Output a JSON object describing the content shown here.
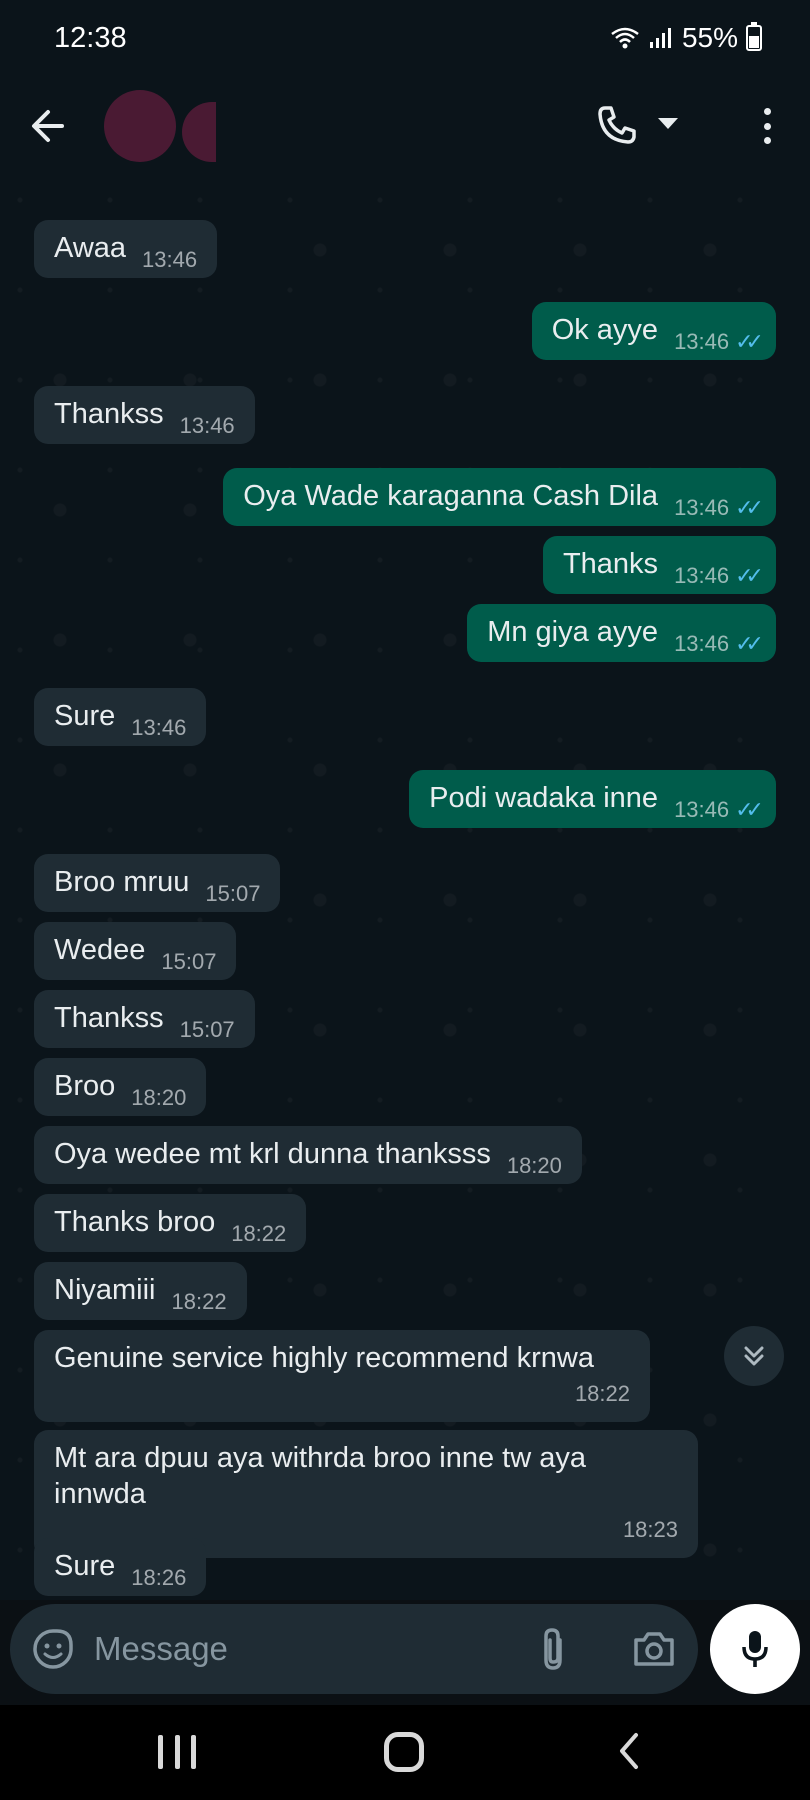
{
  "status_bar": {
    "time": "12:38",
    "battery": "55%",
    "icons": [
      "wifi-icon",
      "signal-icon",
      "battery-icon"
    ]
  },
  "header": {
    "icons": [
      "back-arrow-icon",
      "avatar",
      "phone-call-icon",
      "chevron-down-icon",
      "more-vert-icon"
    ]
  },
  "messages": [
    {
      "dir": "in",
      "text": "Awaa",
      "time": "13:46"
    },
    {
      "dir": "out",
      "text": "Ok ayye",
      "time": "13:46",
      "status": "read"
    },
    {
      "dir": "in",
      "text": "Thankss",
      "time": "13:46"
    },
    {
      "dir": "out",
      "text": "Oya Wade karaganna  Cash Dila",
      "time": "13:46",
      "status": "read"
    },
    {
      "dir": "out",
      "text": "Thanks",
      "time": "13:46",
      "status": "read"
    },
    {
      "dir": "out",
      "text": "Mn giya ayye",
      "time": "13:46",
      "status": "read"
    },
    {
      "dir": "in",
      "text": "Sure",
      "time": "13:46"
    },
    {
      "dir": "out",
      "text": "Podi wadaka inne",
      "time": "13:46",
      "status": "read"
    },
    {
      "dir": "in",
      "text": "Broo mruu",
      "time": "15:07"
    },
    {
      "dir": "in",
      "text": "Wedee",
      "time": "15:07"
    },
    {
      "dir": "in",
      "text": "Thankss",
      "time": "15:07"
    },
    {
      "dir": "in",
      "text": "Broo",
      "time": "18:20"
    },
    {
      "dir": "in",
      "text": "Oya wedee mt krl dunna thanksss",
      "time": "18:20"
    },
    {
      "dir": "in",
      "text": "Thanks broo",
      "time": "18:22"
    },
    {
      "dir": "in",
      "text": "Niyamiii",
      "time": "18:22"
    },
    {
      "dir": "in",
      "text": "Genuine service highly recommend krnwa",
      "time": "18:22"
    },
    {
      "dir": "in",
      "text": "Mt ara dpuu aya withrda broo inne tw aya innwda",
      "time": "18:23"
    },
    {
      "dir": "in",
      "text": "Sure",
      "time": "18:26"
    }
  ],
  "composer": {
    "placeholder": "Message",
    "icons": [
      "emoji-icon",
      "attach-icon",
      "camera-icon",
      "mic-icon"
    ]
  },
  "colors": {
    "background": "#0b141a",
    "incoming_bubble": "#1f2c34",
    "outgoing_bubble": "#005c4b",
    "read_tick": "#53bdeb"
  }
}
